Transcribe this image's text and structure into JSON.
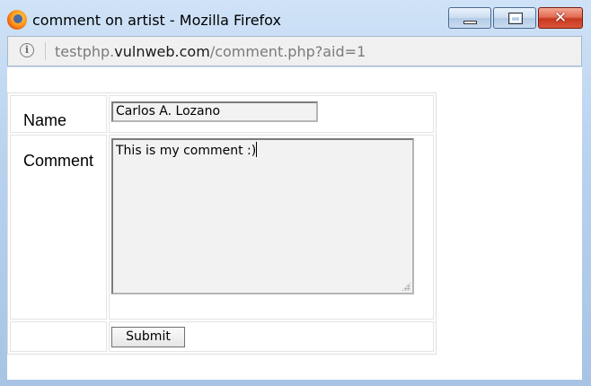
{
  "window": {
    "title": "comment on artist - Mozilla Firefox",
    "controls": {
      "minimize": "minimize",
      "maximize": "maximize",
      "close": "✕"
    }
  },
  "urlbar": {
    "scheme_prefix": "testphp.",
    "host": "vulnweb.com",
    "path": "/comment.php?aid=1"
  },
  "form": {
    "name_label": "Name",
    "name_value": "Carlos A. Lozano",
    "comment_label": "Comment",
    "comment_value": "This is my comment :)",
    "submit_label": "Submit"
  },
  "icons": {
    "app": "firefox-icon",
    "info": "info-icon"
  }
}
